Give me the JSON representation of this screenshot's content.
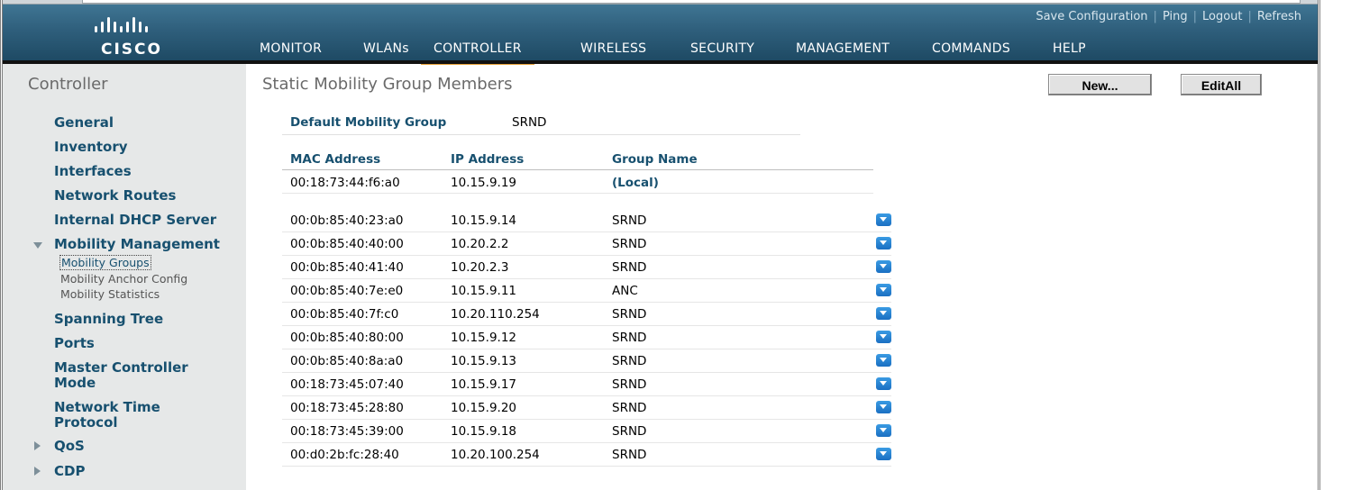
{
  "header": {
    "logo_text": "CISCO",
    "utility_links": {
      "save": "Save Configuration",
      "ping": "Ping",
      "logout": "Logout",
      "refresh": "Refresh",
      "separator": "|"
    },
    "nav": [
      {
        "label": "MONITOR",
        "active": false
      },
      {
        "label": "WLANs",
        "active": false
      },
      {
        "label": "CONTROLLER",
        "active": true
      },
      {
        "label": "WIRELESS",
        "active": false
      },
      {
        "label": "SECURITY",
        "active": false
      },
      {
        "label": "MANAGEMENT",
        "active": false
      },
      {
        "label": "COMMANDS",
        "active": false
      },
      {
        "label": "HELP",
        "active": false
      }
    ],
    "active_tab_color": "#e8a23a"
  },
  "sidebar": {
    "title": "Controller",
    "items": [
      {
        "label": "General"
      },
      {
        "label": "Inventory"
      },
      {
        "label": "Interfaces"
      },
      {
        "label": "Network Routes"
      },
      {
        "label": "Internal DHCP Server"
      },
      {
        "label": "Mobility Management",
        "expanded": true
      },
      {
        "label": "Spanning Tree"
      },
      {
        "label": "Ports"
      },
      {
        "label": "Master Controller Mode"
      },
      {
        "label": "Network Time Protocol"
      },
      {
        "label": "QoS",
        "expanded": false
      },
      {
        "label": "CDP",
        "expanded": false
      }
    ],
    "mobility_subitems": [
      {
        "label": "Mobility Groups",
        "current": true
      },
      {
        "label": "Mobility Anchor Config",
        "current": false
      },
      {
        "label": "Mobility Statistics",
        "current": false
      }
    ],
    "label_color": "#17506f"
  },
  "main": {
    "title": "Static Mobility Group Members",
    "buttons": {
      "new": "New...",
      "edit_all": "EditAll"
    },
    "default_group_label": "Default Mobility Group",
    "default_group_value": "SRND",
    "columns": [
      "MAC Address",
      "IP Address",
      "Group Name"
    ],
    "local_member": {
      "mac": "00:18:73:44:f6:a0",
      "ip": "10.15.9.19",
      "group": "(Local)"
    },
    "members": [
      {
        "mac": "00:0b:85:40:23:a0",
        "ip": "10.15.9.14",
        "group": "SRND"
      },
      {
        "mac": "00:0b:85:40:40:00",
        "ip": "10.20.2.2",
        "group": "SRND"
      },
      {
        "mac": "00:0b:85:40:41:40",
        "ip": "10.20.2.3",
        "group": "SRND"
      },
      {
        "mac": "00:0b:85:40:7e:e0",
        "ip": "10.15.9.11",
        "group": "ANC"
      },
      {
        "mac": "00:0b:85:40:7f:c0",
        "ip": "10.20.110.254",
        "group": "SRND"
      },
      {
        "mac": "00:0b:85:40:80:00",
        "ip": "10.15.9.12",
        "group": "SRND"
      },
      {
        "mac": "00:0b:85:40:8a:a0",
        "ip": "10.15.9.13",
        "group": "SRND"
      },
      {
        "mac": "00:18:73:45:07:40",
        "ip": "10.15.9.17",
        "group": "SRND"
      },
      {
        "mac": "00:18:73:45:28:80",
        "ip": "10.15.9.20",
        "group": "SRND"
      },
      {
        "mac": "00:18:73:45:39:00",
        "ip": "10.15.9.18",
        "group": "SRND"
      },
      {
        "mac": "00:d0:2b:fc:28:40",
        "ip": "10.20.100.254",
        "group": "SRND"
      }
    ],
    "row_action_icon": "dropdown-arrow-icon"
  },
  "figure_id": "222544"
}
